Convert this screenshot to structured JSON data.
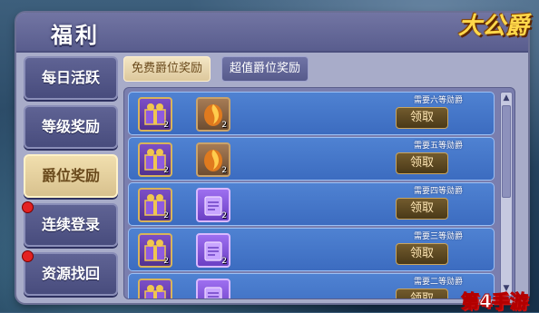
{
  "window": {
    "title": "福利",
    "logo_text": "大公爵"
  },
  "sidebar": {
    "items": [
      {
        "label": "每日活跃",
        "active": false,
        "badge": false
      },
      {
        "label": "等级奖励",
        "active": false,
        "badge": false
      },
      {
        "label": "爵位奖励",
        "active": true,
        "badge": false
      },
      {
        "label": "连续登录",
        "active": false,
        "badge": true
      },
      {
        "label": "资源找回",
        "active": false,
        "badge": true
      }
    ]
  },
  "tabs": [
    {
      "label": "免费爵位奖励",
      "active": true
    },
    {
      "label": "超值爵位奖励",
      "active": false
    }
  ],
  "rewards": [
    {
      "requirement": "需要六等勋爵",
      "button": "领取",
      "items": [
        {
          "icon": "gift-box-icon",
          "count": "2"
        },
        {
          "icon": "flame-relic-icon",
          "count": "2"
        }
      ]
    },
    {
      "requirement": "需要五等勋爵",
      "button": "领取",
      "items": [
        {
          "icon": "gift-box-icon",
          "count": "2"
        },
        {
          "icon": "flame-relic-icon",
          "count": "2"
        }
      ]
    },
    {
      "requirement": "需要四等勋爵",
      "button": "领取",
      "items": [
        {
          "icon": "gift-box-icon",
          "count": "2"
        },
        {
          "icon": "scroll-icon",
          "count": "2"
        }
      ]
    },
    {
      "requirement": "需要三等勋爵",
      "button": "领取",
      "items": [
        {
          "icon": "gift-box-icon",
          "count": "2"
        },
        {
          "icon": "scroll-icon",
          "count": "2"
        }
      ]
    },
    {
      "requirement": "需要二等勋爵",
      "button": "领取",
      "items": [
        {
          "icon": "gift-box-icon",
          "count": ""
        },
        {
          "icon": "scroll-icon",
          "count": ""
        }
      ]
    }
  ],
  "watermark": "第4手游",
  "colors": {
    "accent": "#d8c18e",
    "row_bg": "#4f82d2",
    "badge": "#e32222"
  }
}
